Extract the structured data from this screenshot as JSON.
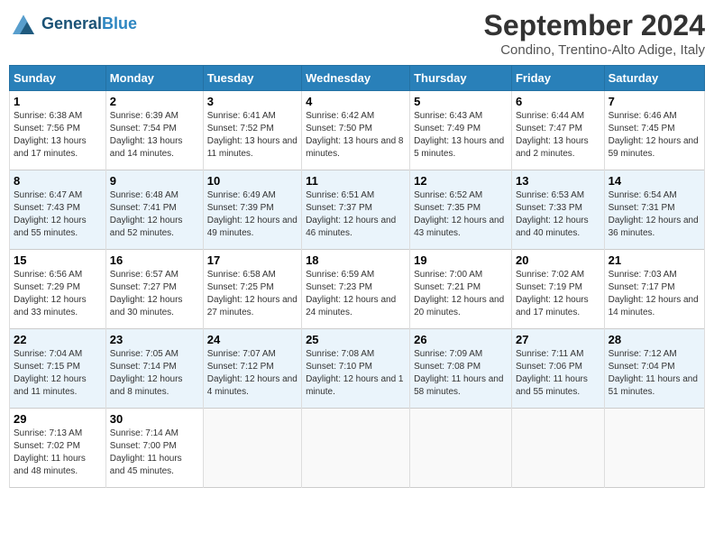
{
  "logo": {
    "general": "General",
    "blue": "Blue"
  },
  "header": {
    "month": "September 2024",
    "location": "Condino, Trentino-Alto Adige, Italy"
  },
  "weekdays": [
    "Sunday",
    "Monday",
    "Tuesday",
    "Wednesday",
    "Thursday",
    "Friday",
    "Saturday"
  ],
  "weeks": [
    [
      {
        "day": 1,
        "sunrise": "6:38 AM",
        "sunset": "7:56 PM",
        "daylight": "13 hours and 17 minutes."
      },
      {
        "day": 2,
        "sunrise": "6:39 AM",
        "sunset": "7:54 PM",
        "daylight": "13 hours and 14 minutes."
      },
      {
        "day": 3,
        "sunrise": "6:41 AM",
        "sunset": "7:52 PM",
        "daylight": "13 hours and 11 minutes."
      },
      {
        "day": 4,
        "sunrise": "6:42 AM",
        "sunset": "7:50 PM",
        "daylight": "13 hours and 8 minutes."
      },
      {
        "day": 5,
        "sunrise": "6:43 AM",
        "sunset": "7:49 PM",
        "daylight": "13 hours and 5 minutes."
      },
      {
        "day": 6,
        "sunrise": "6:44 AM",
        "sunset": "7:47 PM",
        "daylight": "13 hours and 2 minutes."
      },
      {
        "day": 7,
        "sunrise": "6:46 AM",
        "sunset": "7:45 PM",
        "daylight": "12 hours and 59 minutes."
      }
    ],
    [
      {
        "day": 8,
        "sunrise": "6:47 AM",
        "sunset": "7:43 PM",
        "daylight": "12 hours and 55 minutes."
      },
      {
        "day": 9,
        "sunrise": "6:48 AM",
        "sunset": "7:41 PM",
        "daylight": "12 hours and 52 minutes."
      },
      {
        "day": 10,
        "sunrise": "6:49 AM",
        "sunset": "7:39 PM",
        "daylight": "12 hours and 49 minutes."
      },
      {
        "day": 11,
        "sunrise": "6:51 AM",
        "sunset": "7:37 PM",
        "daylight": "12 hours and 46 minutes."
      },
      {
        "day": 12,
        "sunrise": "6:52 AM",
        "sunset": "7:35 PM",
        "daylight": "12 hours and 43 minutes."
      },
      {
        "day": 13,
        "sunrise": "6:53 AM",
        "sunset": "7:33 PM",
        "daylight": "12 hours and 40 minutes."
      },
      {
        "day": 14,
        "sunrise": "6:54 AM",
        "sunset": "7:31 PM",
        "daylight": "12 hours and 36 minutes."
      }
    ],
    [
      {
        "day": 15,
        "sunrise": "6:56 AM",
        "sunset": "7:29 PM",
        "daylight": "12 hours and 33 minutes."
      },
      {
        "day": 16,
        "sunrise": "6:57 AM",
        "sunset": "7:27 PM",
        "daylight": "12 hours and 30 minutes."
      },
      {
        "day": 17,
        "sunrise": "6:58 AM",
        "sunset": "7:25 PM",
        "daylight": "12 hours and 27 minutes."
      },
      {
        "day": 18,
        "sunrise": "6:59 AM",
        "sunset": "7:23 PM",
        "daylight": "12 hours and 24 minutes."
      },
      {
        "day": 19,
        "sunrise": "7:00 AM",
        "sunset": "7:21 PM",
        "daylight": "12 hours and 20 minutes."
      },
      {
        "day": 20,
        "sunrise": "7:02 AM",
        "sunset": "7:19 PM",
        "daylight": "12 hours and 17 minutes."
      },
      {
        "day": 21,
        "sunrise": "7:03 AM",
        "sunset": "7:17 PM",
        "daylight": "12 hours and 14 minutes."
      }
    ],
    [
      {
        "day": 22,
        "sunrise": "7:04 AM",
        "sunset": "7:15 PM",
        "daylight": "12 hours and 11 minutes."
      },
      {
        "day": 23,
        "sunrise": "7:05 AM",
        "sunset": "7:14 PM",
        "daylight": "12 hours and 8 minutes."
      },
      {
        "day": 24,
        "sunrise": "7:07 AM",
        "sunset": "7:12 PM",
        "daylight": "12 hours and 4 minutes."
      },
      {
        "day": 25,
        "sunrise": "7:08 AM",
        "sunset": "7:10 PM",
        "daylight": "12 hours and 1 minute."
      },
      {
        "day": 26,
        "sunrise": "7:09 AM",
        "sunset": "7:08 PM",
        "daylight": "11 hours and 58 minutes."
      },
      {
        "day": 27,
        "sunrise": "7:11 AM",
        "sunset": "7:06 PM",
        "daylight": "11 hours and 55 minutes."
      },
      {
        "day": 28,
        "sunrise": "7:12 AM",
        "sunset": "7:04 PM",
        "daylight": "11 hours and 51 minutes."
      }
    ],
    [
      {
        "day": 29,
        "sunrise": "7:13 AM",
        "sunset": "7:02 PM",
        "daylight": "11 hours and 48 minutes."
      },
      {
        "day": 30,
        "sunrise": "7:14 AM",
        "sunset": "7:00 PM",
        "daylight": "11 hours and 45 minutes."
      },
      null,
      null,
      null,
      null,
      null
    ]
  ]
}
